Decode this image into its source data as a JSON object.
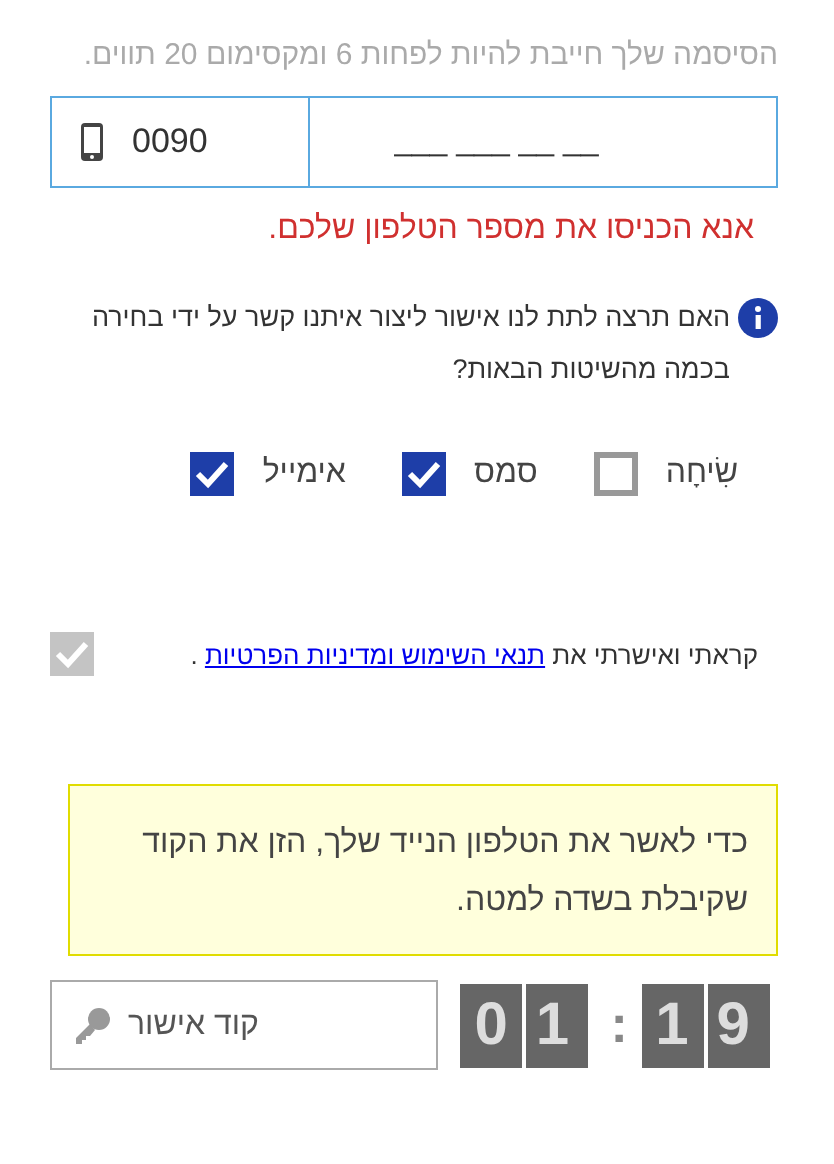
{
  "password_hint": "הסיסמה שלך חייבת להיות לפחות 6 ומקסימום 20 תווים.",
  "phone": {
    "prefix": "0090",
    "value": "___ ___ __ __"
  },
  "phone_error": "אנא הכניסו את מספר הטלפון שלכם.",
  "contact_question": "האם תרצה לתת לנו אישור ליצור איתנו קשר על ידי בחירה בכמה מהשיטות הבאות?",
  "contact_methods": [
    {
      "label": "שִׂיחָה",
      "checked": false
    },
    {
      "label": "סמס",
      "checked": true
    },
    {
      "label": "אימייל",
      "checked": true
    }
  ],
  "consent": {
    "before": "קראתי ואישרתי את",
    "link": "תנאי השימוש ומדיניות הפרטיות",
    "after": ".",
    "checked": true,
    "disabled": true
  },
  "notice": "כדי לאשר את הטלפון הנייד שלך, הזן את הקוד שקיבלת בשדה למטה.",
  "code_field": {
    "placeholder": "קוד אישור"
  },
  "timer": {
    "minutes": "01",
    "separator": ":",
    "seconds": "19"
  }
}
